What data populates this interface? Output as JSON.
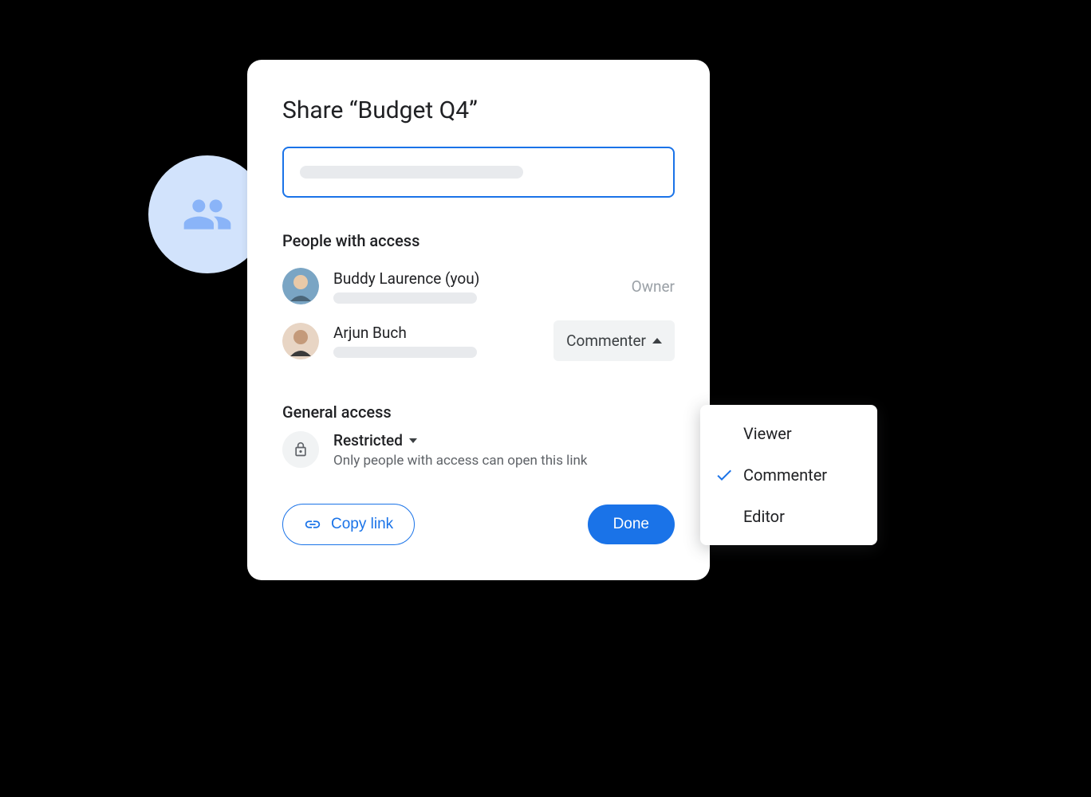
{
  "dialog": {
    "title": "Share “Budget Q4”",
    "people_section_header": "People with access",
    "general_section_header": "General access"
  },
  "people": [
    {
      "name": "Buddy Laurence (you)",
      "role": "Owner"
    },
    {
      "name": "Arjun Buch",
      "role": "Commenter"
    }
  ],
  "general": {
    "access_label": "Restricted",
    "description": "Only people with access can open this link"
  },
  "buttons": {
    "copy_link": "Copy link",
    "done": "Done"
  },
  "menu": {
    "options": [
      "Viewer",
      "Commenter",
      "Editor"
    ],
    "selected": "Commenter"
  }
}
